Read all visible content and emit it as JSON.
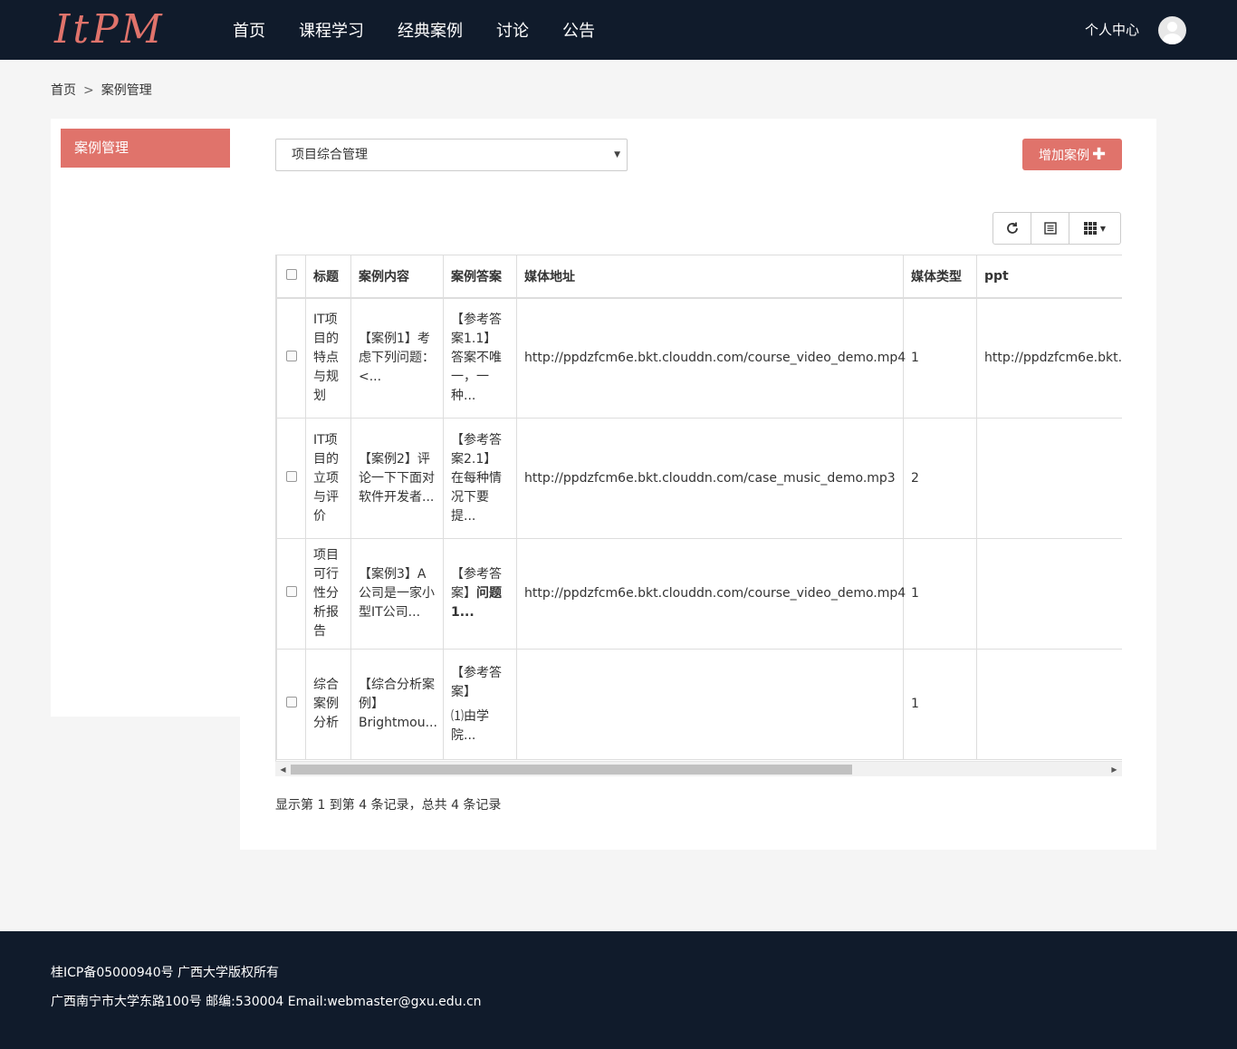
{
  "header": {
    "logo": "ItPM",
    "nav": [
      "首页",
      "课程学习",
      "经典案例",
      "讨论",
      "公告"
    ],
    "user_center": "个人中心"
  },
  "breadcrumb": {
    "home": "首页",
    "separator": ">",
    "current": "案例管理"
  },
  "sidebar": {
    "items": [
      {
        "label": "案例管理"
      }
    ]
  },
  "main": {
    "select_value": "项目综合管理",
    "add_button": "增加案例"
  },
  "table": {
    "columns": [
      "标题",
      "案例内容",
      "案例答案",
      "媒体地址",
      "媒体类型",
      "ppt"
    ],
    "rows": [
      {
        "title": "IT项目的特点与规划",
        "content": "【案例1】考虑下列问题：<...",
        "answer": "【参考答案1.1】答案不唯一，一种...",
        "media_url": "http://ppdzfcm6e.bkt.clouddn.com/course_video_demo.mp4",
        "media_type": "1",
        "ppt": "http://ppdzfcm6e.bkt.c"
      },
      {
        "title": "IT项目的立项与评价",
        "content": "【案例2】评论一下下面对软件开发者...",
        "answer": "【参考答案2.1】在每种情况下要提...",
        "media_url": "http://ppdzfcm6e.bkt.clouddn.com/case_music_demo.mp3",
        "media_type": "2",
        "ppt": ""
      },
      {
        "title": "项目可行性分析报告",
        "content": "【案例3】A公司是一家小型IT公司...",
        "answer_prefix": "【参考答案】",
        "answer_bold": "问题1...",
        "media_url": "http://ppdzfcm6e.bkt.clouddn.com/course_video_demo.mp4",
        "media_type": "1",
        "ppt": ""
      },
      {
        "title": "综合案例分析",
        "content": "【综合分析案例】Brightmou...",
        "answer_line1": "【参考答案】",
        "answer_line2": "⑴由学院...",
        "media_url": "",
        "media_type": "1",
        "ppt": ""
      }
    ]
  },
  "pagination": {
    "info": "显示第 1 到第 4 条记录，总共 4 条记录"
  },
  "footer": {
    "line1": "桂ICP备05000940号 广西大学版权所有",
    "line2": "广西南宁市大学东路100号 邮编:530004 Email:webmaster@gxu.edu.cn"
  },
  "colors": {
    "accent": "#e0736b",
    "header_bg": "#101b2b"
  }
}
